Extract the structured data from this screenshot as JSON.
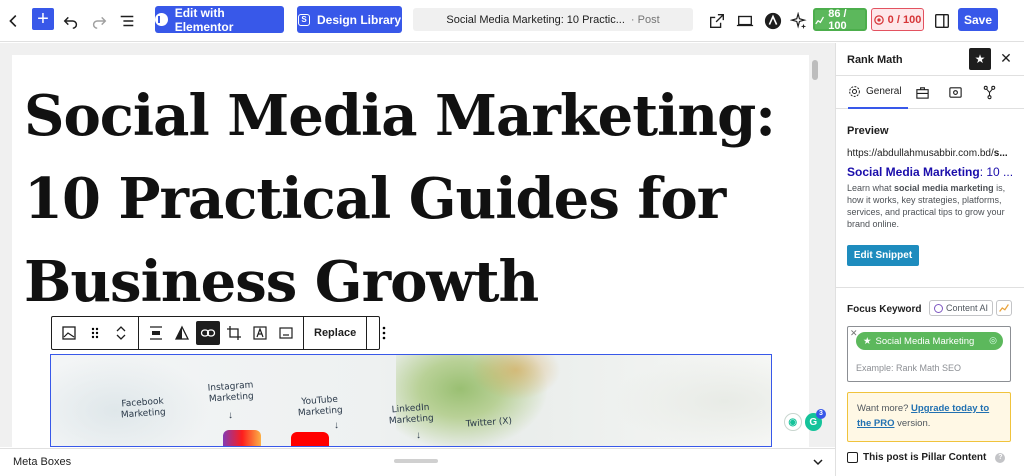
{
  "topbar": {
    "elementor_label": "Edit with Elementor",
    "design_library_label": "Design Library",
    "doc_title": "Social Media Marketing: 10 Practic...",
    "doc_type": "· Post",
    "seo_score": "86 / 100",
    "readability_score": "0 / 100",
    "save_label": "Save",
    "accent": "#3858e9"
  },
  "editor": {
    "post_title": "Social Media Marketing: 10 Practical Guides for Business Growth",
    "toolbar": {
      "replace_label": "Replace"
    },
    "image_labels": [
      "Facebook Marketing",
      "Instagram Marketing",
      "YouTube Marketing",
      "LinkedIn Marketing",
      "Twitter (X)"
    ]
  },
  "meta_boxes": {
    "label": "Meta Boxes"
  },
  "sidebar": {
    "title": "Rank Math",
    "tab_general": "General",
    "preview": {
      "heading": "Preview",
      "url_prefix": "https://abdullahmusabbir.com.bd/",
      "url_bold": "s...",
      "title_bold": "Social Media Marketing",
      "title_rest": ": 10 ...",
      "desc_1": "Learn what ",
      "desc_bold": "social media marketing",
      "desc_2": " is, how it works, key strategies, platforms, services, and practical tips to grow your brand online.",
      "edit_snippet_label": "Edit Snippet"
    },
    "focus_keyword": {
      "label": "Focus Keyword",
      "content_ai_label": "Content AI",
      "keyword": "Social Media Marketing",
      "placeholder": "Example: Rank Math SEO"
    },
    "upgrade": {
      "text_1": "Want more? ",
      "link": "Upgrade today to the PRO",
      "text_2": " version."
    },
    "pillar_label": "This post is Pillar Content"
  }
}
